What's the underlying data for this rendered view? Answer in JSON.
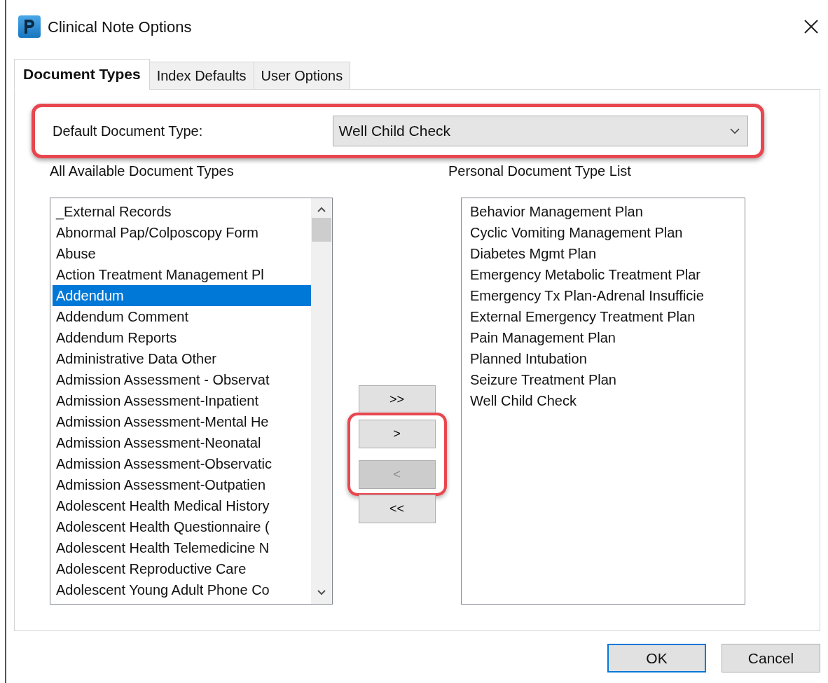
{
  "window": {
    "title": "Clinical Note Options"
  },
  "tabs": [
    {
      "label": "Document Types",
      "selected": true
    },
    {
      "label": "Index Defaults",
      "selected": false
    },
    {
      "label": "User Options",
      "selected": false
    }
  ],
  "default_document_type": {
    "label": "Default Document Type:",
    "value": "Well Child Check",
    "highlighted": true
  },
  "available_list": {
    "heading": "All Available Document Types",
    "items": [
      {
        "label": "_External Records",
        "selected": false
      },
      {
        "label": "Abnormal Pap/Colposcopy Form",
        "selected": false
      },
      {
        "label": "Abuse",
        "selected": false
      },
      {
        "label": "Action Treatment Management Pl",
        "selected": false
      },
      {
        "label": "Addendum",
        "selected": true
      },
      {
        "label": "Addendum Comment",
        "selected": false
      },
      {
        "label": "Addendum Reports",
        "selected": false
      },
      {
        "label": "Administrative Data Other",
        "selected": false
      },
      {
        "label": "Admission Assessment - Observat",
        "selected": false
      },
      {
        "label": "Admission Assessment-Inpatient",
        "selected": false
      },
      {
        "label": "Admission Assessment-Mental He",
        "selected": false
      },
      {
        "label": "Admission Assessment-Neonatal",
        "selected": false
      },
      {
        "label": "Admission Assessment-Observatic",
        "selected": false
      },
      {
        "label": "Admission Assessment-Outpatien",
        "selected": false
      },
      {
        "label": "Adolescent Health Medical History",
        "selected": false
      },
      {
        "label": "Adolescent Health Questionnaire (",
        "selected": false
      },
      {
        "label": "Adolescent Health Telemedicine N",
        "selected": false
      },
      {
        "label": "Adolescent Reproductive Care",
        "selected": false
      },
      {
        "label": "Adolescent Young Adult Phone Co",
        "selected": false
      }
    ]
  },
  "move_buttons": [
    {
      "label": ">>",
      "disabled": false,
      "highlighted": false
    },
    {
      "label": ">",
      "disabled": false,
      "highlighted": true
    },
    {
      "label": "<",
      "disabled": true,
      "highlighted": true
    },
    {
      "label": "<<",
      "disabled": false,
      "highlighted": false
    }
  ],
  "personal_list": {
    "heading": "Personal Document Type List",
    "items": [
      {
        "label": "Behavior Management Plan",
        "selected": false
      },
      {
        "label": "Cyclic Vomiting Management Plan",
        "selected": false
      },
      {
        "label": "Diabetes Mgmt Plan",
        "selected": false
      },
      {
        "label": "Emergency Metabolic Treatment Plar",
        "selected": false
      },
      {
        "label": "Emergency Tx Plan-Adrenal Insufficie",
        "selected": false
      },
      {
        "label": "External Emergency Treatment Plan",
        "selected": false
      },
      {
        "label": "Pain Management Plan",
        "selected": false
      },
      {
        "label": "Planned Intubation",
        "selected": false
      },
      {
        "label": "Seizure Treatment Plan",
        "selected": false
      },
      {
        "label": "Well Child Check",
        "selected": false
      }
    ]
  },
  "buttons": [
    {
      "label": "OK",
      "default": true
    },
    {
      "label": "Cancel",
      "default": false
    }
  ]
}
